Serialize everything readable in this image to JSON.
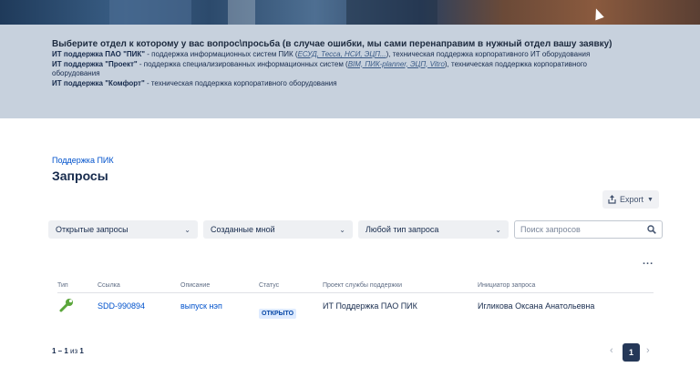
{
  "info": {
    "heading": "Выберите отдел к которому у вас вопрос\\просьба (в случае ошибки, мы сами перенаправим в нужный отдел вашу заявку)",
    "lines": [
      {
        "name": "ИТ поддержка ПАО \"ПИК\"",
        "pre": " - поддержка информационных систем ПИК (",
        "link": "ЕСУД, Тесса, НСИ, ЭЦП...",
        "post": "), техническая поддержка корпоративного ИТ оборудования"
      },
      {
        "name": "ИТ поддержка \"Проект\"",
        "pre": " - поддержка специализированных информационных систем (",
        "link": "BIM, ПИК-planner, ЭЦП, Vitro",
        "post": "), техническая поддержка корпоративного оборудования"
      },
      {
        "name": "ИТ поддержка \"Комфорт\"",
        "pre": " - техническая поддержка корпоративного оборудования",
        "link": "",
        "post": ""
      }
    ]
  },
  "breadcrumb": "Поддержка ПИК",
  "page_title": "Запросы",
  "export_label": "Export",
  "filters": {
    "status": "Открытые запросы",
    "creator": "Созданные мной",
    "type": "Любой тип запроса",
    "search_placeholder": "Поиск запросов"
  },
  "more_label": "...",
  "table": {
    "headers": {
      "type": "Тип",
      "ref": "Ссылка",
      "desc": "Описание",
      "status": "Статус",
      "project": "Проект службы поддержки",
      "initiator": "Инициатор запроса"
    },
    "rows": [
      {
        "ref": "SDD-990894",
        "desc": "выпуск нэп",
        "status": "ОТКРЫТО",
        "project": "ИТ Поддержка ПАО ПИК",
        "initiator": "Игликова Оксана Анатольевна"
      }
    ]
  },
  "pager": {
    "range": "1 – 1",
    "of": "из",
    "total": "1",
    "current_page": "1"
  },
  "icons": {
    "type_icon": "wrench-icon",
    "export_icon": "share-icon",
    "search_icon": "search-icon"
  },
  "colors": {
    "accent": "#0052cc",
    "banner_bg": "#c7d1dd",
    "badge_bg": "#deebff"
  }
}
